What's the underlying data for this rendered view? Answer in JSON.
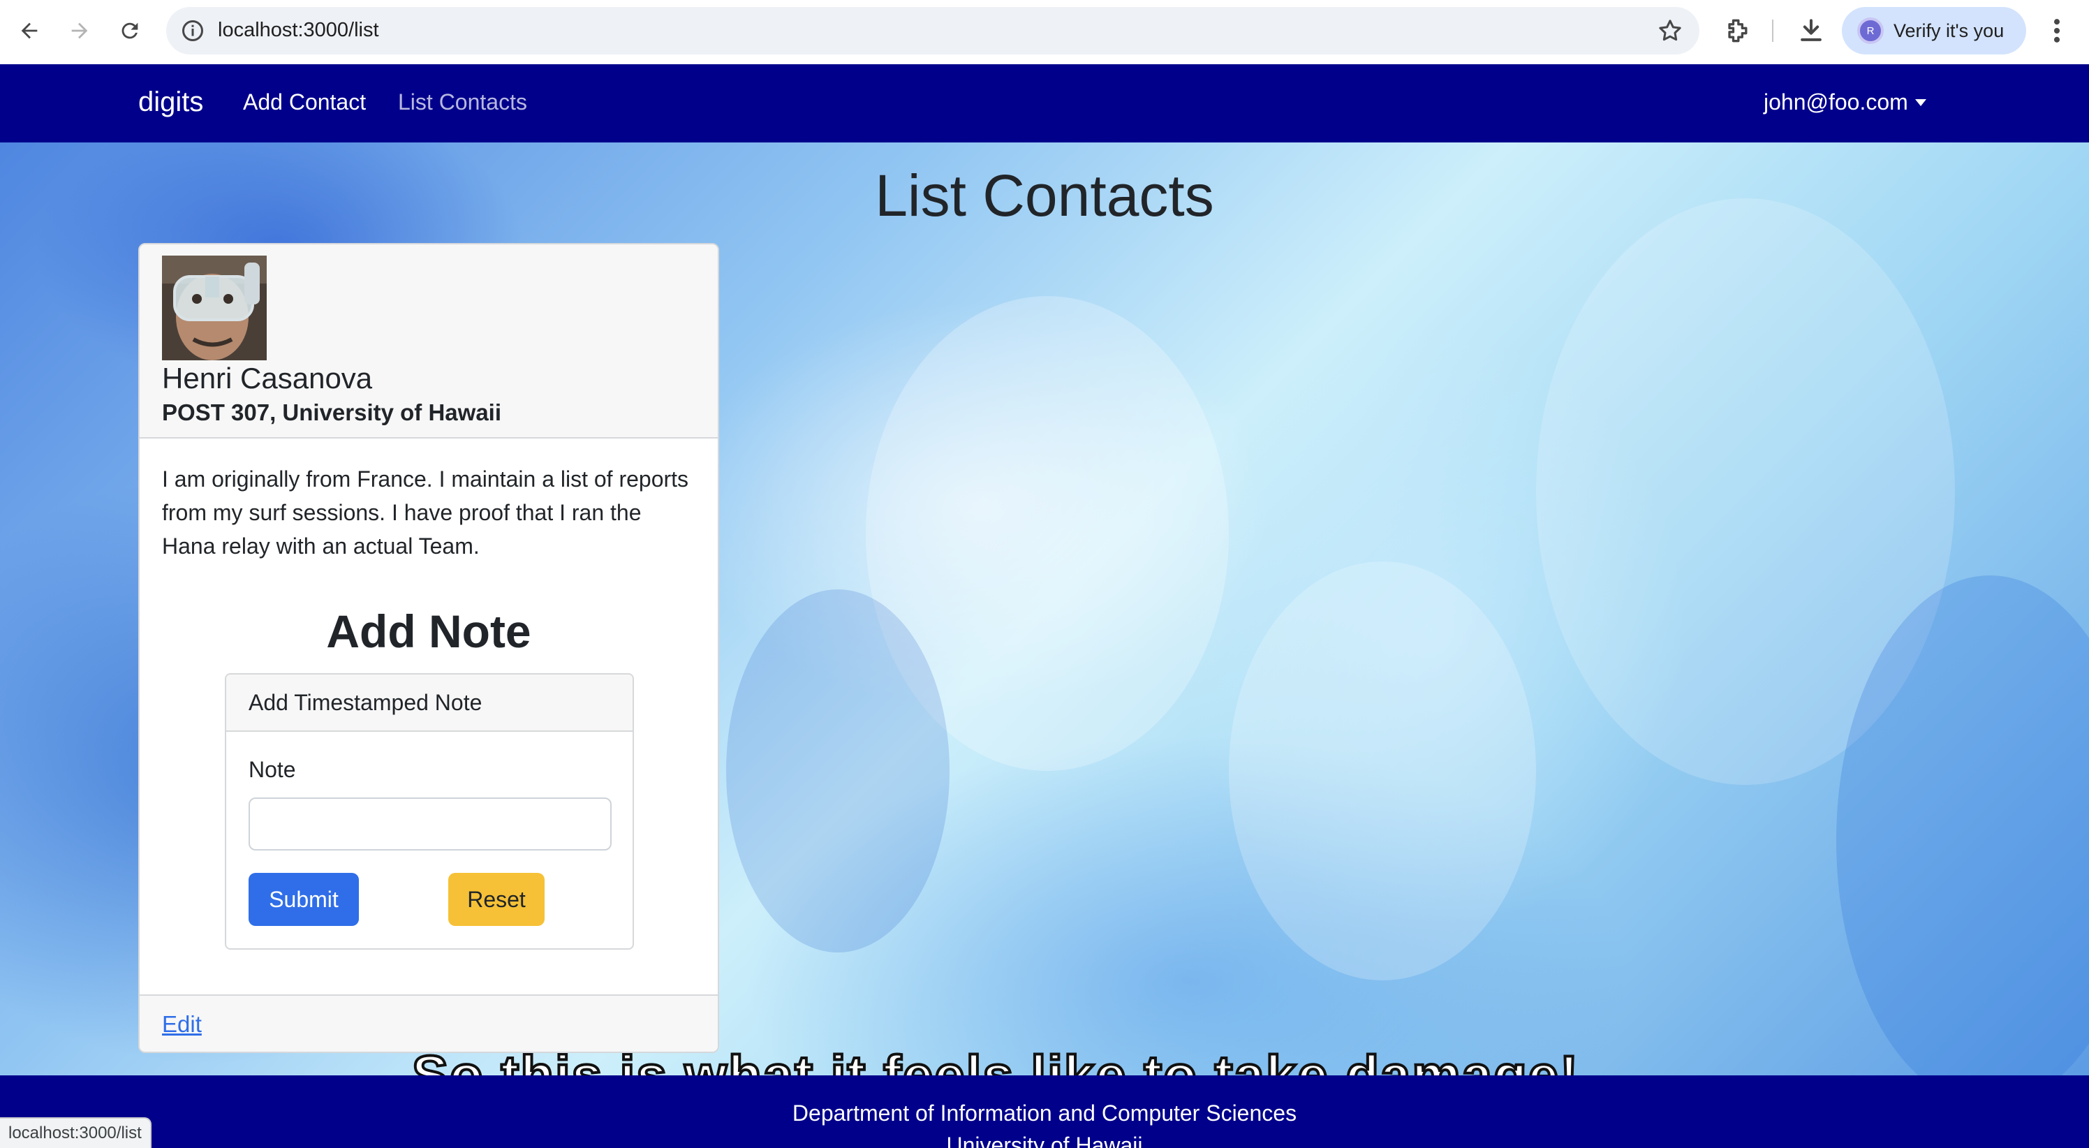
{
  "browser": {
    "url": "localhost:3000/list",
    "verify_label": "Verify it's you",
    "profile_initial": "R",
    "status_url": "localhost:3000/list"
  },
  "navbar": {
    "brand": "digits",
    "links": [
      {
        "label": "Add Contact",
        "active": true
      },
      {
        "label": "List Contacts",
        "active": false
      }
    ],
    "user": "john@foo.com"
  },
  "page": {
    "title": "List Contacts",
    "background_caption": "So this is what it feels like to take damage!"
  },
  "contact": {
    "name": "Henri Casanova",
    "address": "POST 307, University of Hawaii",
    "description": "I am originally from France. I maintain a list of reports from my surf sessions. I have proof that I ran the Hana relay with an actual Team.",
    "note_section": {
      "heading": "Add Note",
      "card_title": "Add Timestamped Note",
      "field_label": "Note",
      "field_value": "",
      "submit_label": "Submit",
      "reset_label": "Reset"
    },
    "edit_label": "Edit"
  },
  "footer": {
    "line1": "Department of Information and Computer Sciences",
    "line2": "University of Hawaii"
  },
  "colors": {
    "navbar_bg": "#00008b",
    "primary": "#2f6ee8",
    "warning": "#f6c136",
    "verify_chip": "#d3e3fd"
  }
}
